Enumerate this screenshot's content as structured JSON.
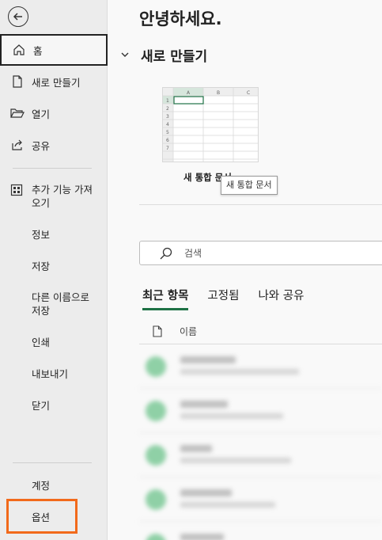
{
  "sidebar": {
    "items": [
      {
        "label": "홈"
      },
      {
        "label": "새로 만들기"
      },
      {
        "label": "열기"
      },
      {
        "label": "공유"
      },
      {
        "label": "추가 기능 가져오기"
      },
      {
        "label": "정보"
      },
      {
        "label": "저장"
      },
      {
        "label": "다른 이름으로 저장"
      },
      {
        "label": "인쇄"
      },
      {
        "label": "내보내기"
      },
      {
        "label": "닫기"
      },
      {
        "label": "계정"
      },
      {
        "label": "옵션"
      }
    ],
    "addins_line1": "추가 기능 가져",
    "addins_line2": "오기",
    "saveas_line1": "다른 이름으로",
    "saveas_line2": "저장"
  },
  "main": {
    "greeting": "안녕하세요.",
    "new_section_title": "새로 만들기",
    "template": {
      "name": "새 통합 문서",
      "tooltip": "새 통합 문서",
      "columns": [
        "A",
        "B",
        "C"
      ],
      "rows": [
        "1",
        "2",
        "3",
        "4",
        "5",
        "6",
        "7"
      ]
    },
    "search": {
      "placeholder": "검색"
    },
    "tabs": [
      {
        "label": "최근 항목"
      },
      {
        "label": "고정됨"
      },
      {
        "label": "나와 공유"
      }
    ],
    "list_header": "이름"
  },
  "colors": {
    "accent": "#1e7145",
    "highlight": "#f26a1b"
  }
}
